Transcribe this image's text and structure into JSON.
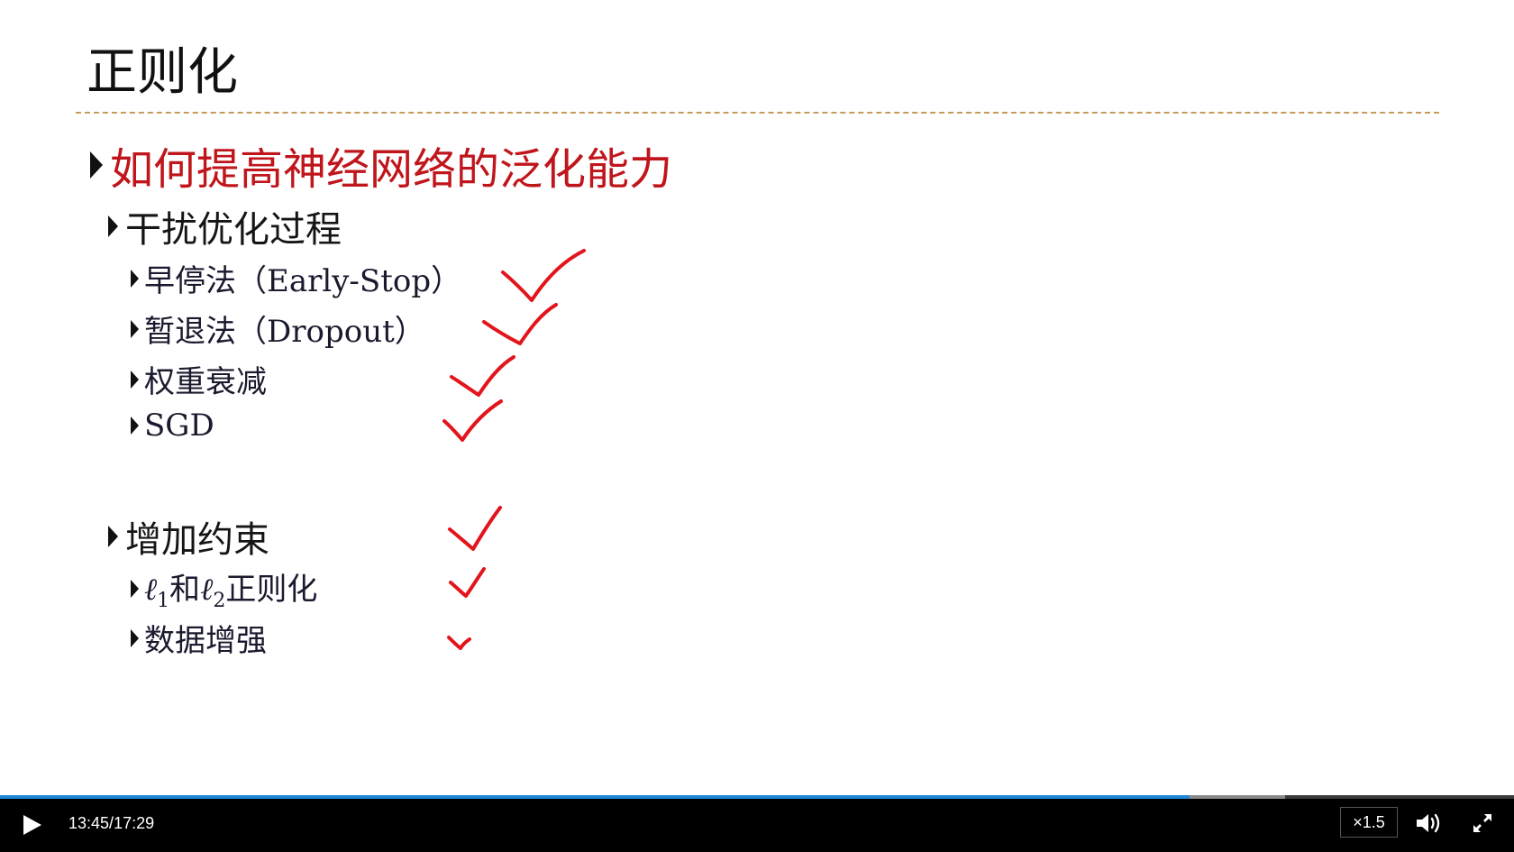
{
  "slide": {
    "title": "正则化",
    "heading": "如何提高神经网络的泛化能力",
    "group1": {
      "label": "干扰优化过程",
      "items": [
        "早停法（Early-Stop）",
        "暂退法（Dropout）",
        "权重衰减",
        "SGD"
      ]
    },
    "group2": {
      "label": "增加约束",
      "l1l2": {
        "ell": "ℓ",
        "sub1": "1",
        "and": "和",
        "sub2": "2",
        "suffix": "正则化"
      },
      "augment": "数据增强"
    },
    "colors": {
      "heading": "#c0151b",
      "check": "#e3141b",
      "divider": "#c79b5d"
    }
  },
  "player": {
    "current_time": "13:45",
    "separator": "/",
    "duration": "17:29",
    "progress_fraction": 0.786,
    "buffered_fraction": 0.849,
    "speed": "×1.5",
    "icons": [
      "play-icon",
      "volume-icon",
      "fullscreen-icon"
    ],
    "colors": {
      "progress": "#1e88d6",
      "background": "#000000"
    }
  }
}
